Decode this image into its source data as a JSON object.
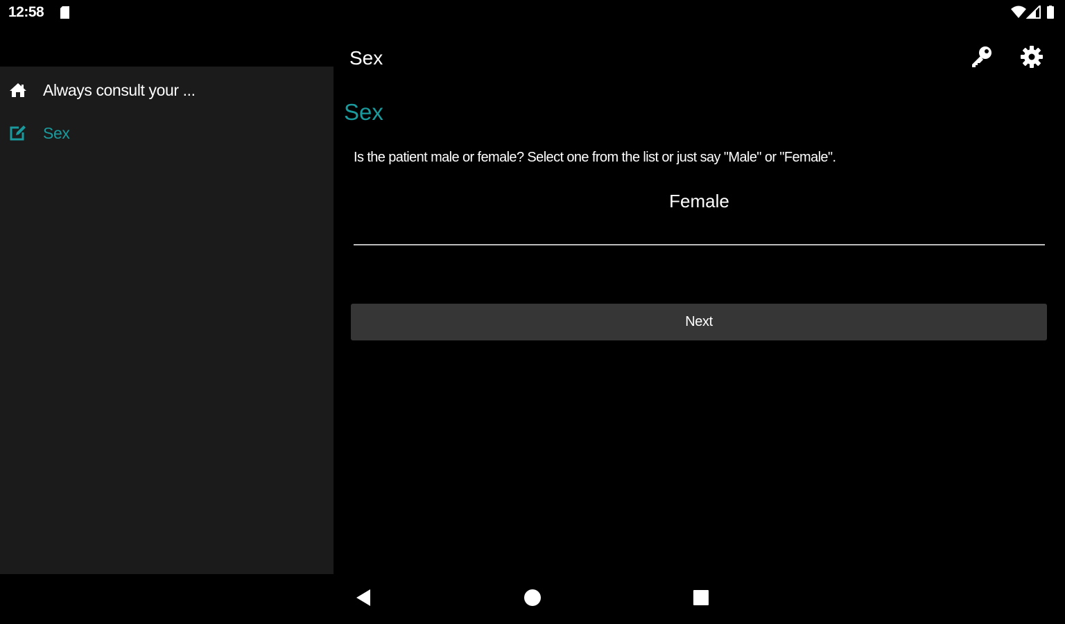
{
  "status_bar": {
    "time": "12:58",
    "icons": [
      "sd-card-icon",
      "wifi-icon",
      "signal-icon",
      "battery-icon"
    ]
  },
  "sidebar": {
    "items": [
      {
        "label": "Always consult your ...",
        "icon": "home-icon",
        "selected": false
      },
      {
        "label": "Sex",
        "icon": "edit-icon",
        "selected": true
      }
    ]
  },
  "appbar": {
    "title": "Sex",
    "actions": [
      "key-icon",
      "gear-icon"
    ]
  },
  "main": {
    "heading": "Sex",
    "question": "Is the patient male or female?  Select one from the list or just say \"Male\" or \"Female\".",
    "answer_value": "Female",
    "next_label": "Next"
  },
  "colors": {
    "accent": "#1a9a9c",
    "sidebar_bg": "#1b1b1b",
    "background": "#000000",
    "button_bg": "#363636"
  },
  "nav_bar": {
    "buttons": [
      "back-icon",
      "home-circle-icon",
      "recents-icon"
    ]
  }
}
